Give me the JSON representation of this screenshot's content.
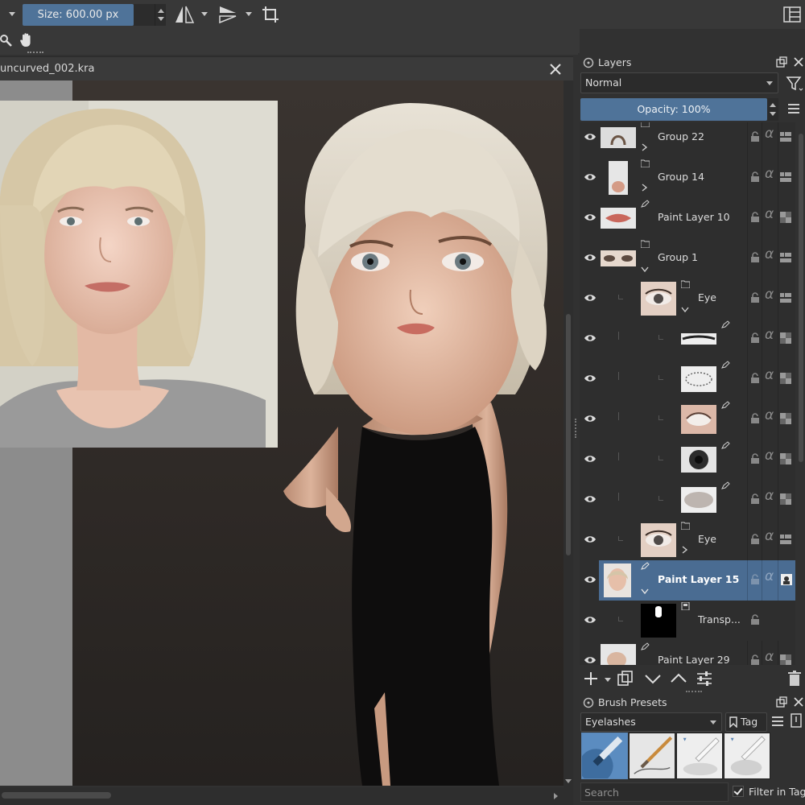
{
  "toolbar": {
    "size_label": "Size: 600.00 px"
  },
  "document": {
    "title": "uncurved_002.kra"
  },
  "layers_docker": {
    "title": "Layers",
    "blend_mode": "Normal",
    "opacity_label": "Opacity:  100%",
    "layers": [
      {
        "name": "Group 22",
        "type": "group"
      },
      {
        "name": "Group 14",
        "type": "group"
      },
      {
        "name": "Paint Layer 10",
        "type": "paint"
      },
      {
        "name": "Group 1",
        "type": "group"
      },
      {
        "name": "Eye",
        "type": "group"
      },
      {
        "name": "",
        "type": "paint"
      },
      {
        "name": "",
        "type": "paint"
      },
      {
        "name": "",
        "type": "paint"
      },
      {
        "name": "",
        "type": "paint"
      },
      {
        "name": "",
        "type": "paint"
      },
      {
        "name": "Eye",
        "type": "group"
      },
      {
        "name": "Paint Layer 15",
        "type": "paint",
        "selected": true
      },
      {
        "name": "Transp...",
        "type": "transparency-mask"
      },
      {
        "name": "Paint Layer 29",
        "type": "paint"
      }
    ]
  },
  "brush_presets": {
    "title": "Brush Presets",
    "tag_filter": "Eyelashes",
    "tag_button": "Tag",
    "search_placeholder": "Search",
    "filter_in_tag_label": "Filter in Tag",
    "filter_in_tag_checked": true
  },
  "colors": {
    "accent": "#4f7399",
    "selected_row": "#4a6c92",
    "panel_bg": "#313131"
  }
}
